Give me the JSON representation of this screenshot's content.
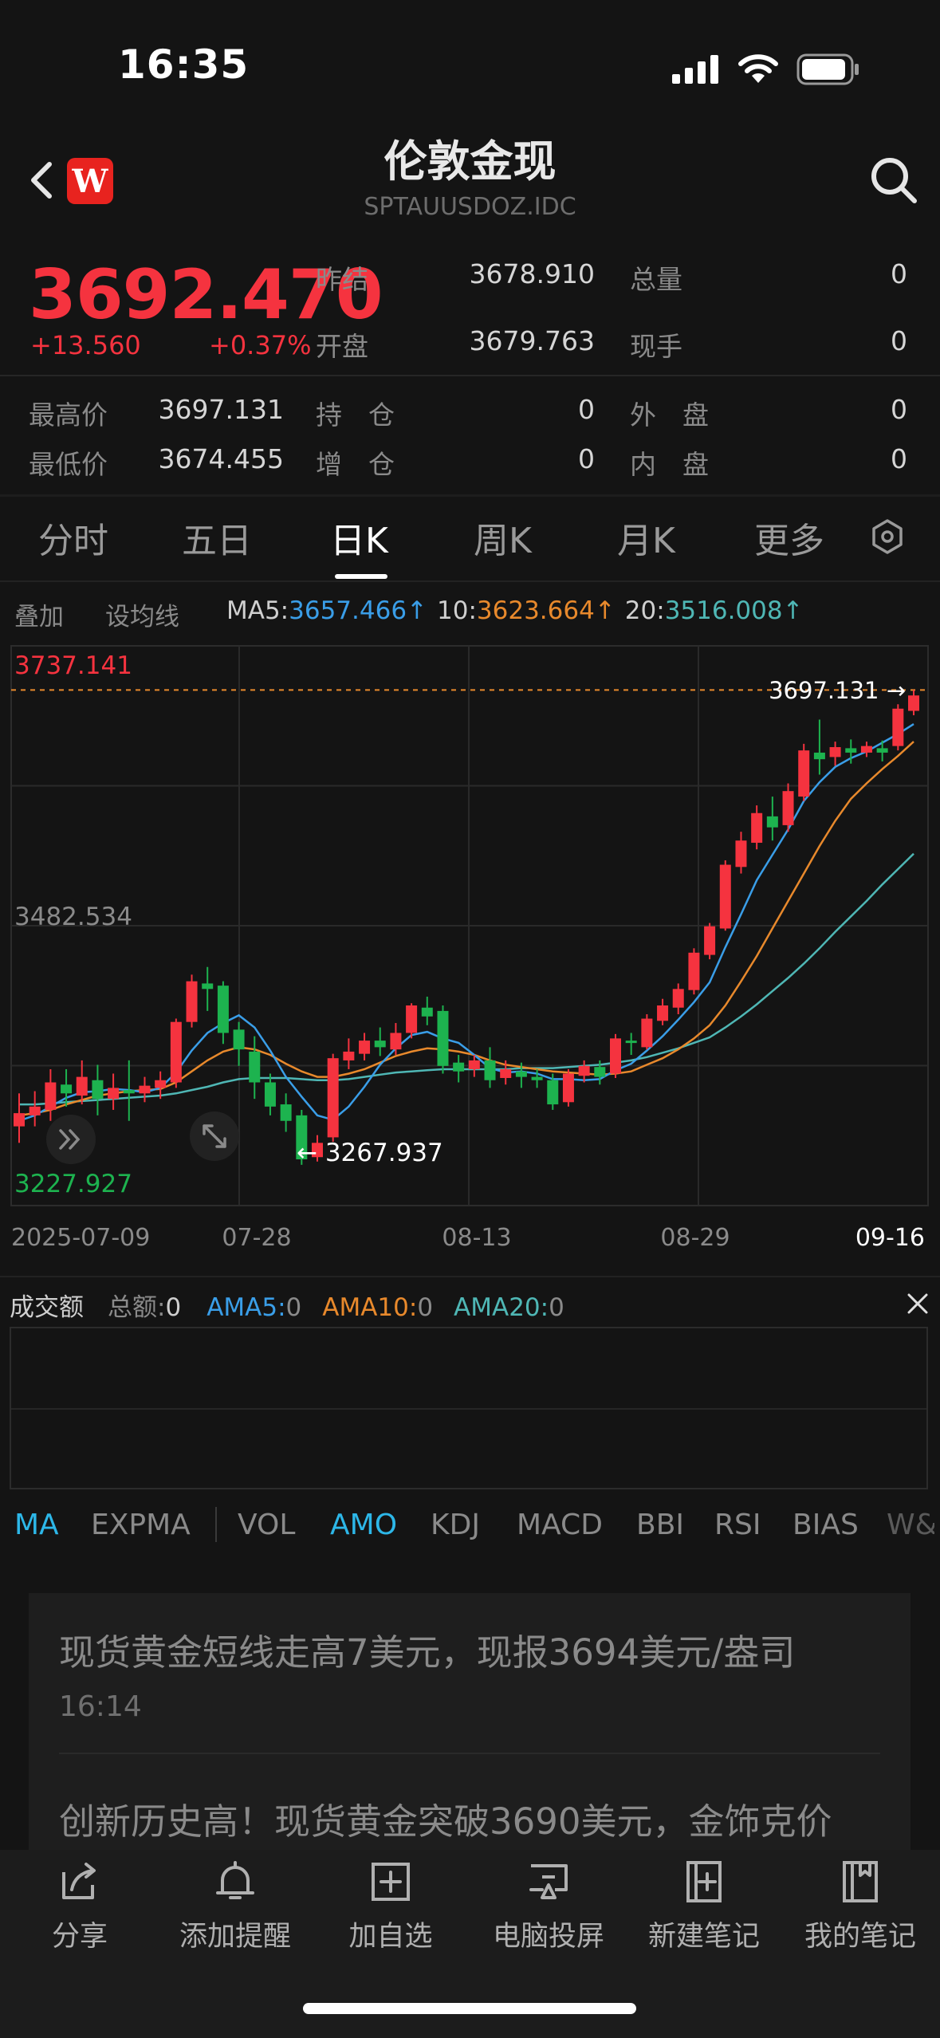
{
  "status": {
    "time": "16:35"
  },
  "header": {
    "title": "伦敦金现",
    "subtitle": "SPTAUUSDOZ.IDC",
    "logo": "W"
  },
  "quote": {
    "price": "3692.470",
    "change": "+13.560",
    "change_pct": "+0.37%",
    "fields": [
      {
        "label": "昨结",
        "value": "3678.910"
      },
      {
        "label": "总量",
        "value": "0"
      },
      {
        "label": "开盘",
        "value": "3679.763"
      },
      {
        "label": "现手",
        "value": "0"
      },
      {
        "label": "最高价",
        "value": "3697.131"
      },
      {
        "label": "持　仓",
        "value": "0"
      },
      {
        "label": "外　盘",
        "value": "0"
      },
      {
        "label": "最低价",
        "value": "3674.455"
      },
      {
        "label": "增　仓",
        "value": "0"
      },
      {
        "label": "内　盘",
        "value": "0"
      }
    ]
  },
  "tabs": [
    "分时",
    "五日",
    "日K",
    "周K",
    "月K",
    "更多"
  ],
  "active_tab": "日K",
  "ma_bar": {
    "overlay": "叠加",
    "set_ma": "设均线",
    "ma5_label": "MA5:",
    "ma5_value": "3657.466↑",
    "ma10_label": "10:",
    "ma10_value": "3623.664↑",
    "ma20_label": "20:",
    "ma20_value": "3516.008↑"
  },
  "chart_data": {
    "type": "candlestick",
    "y_top_label": "3737.141",
    "y_mid_label": "3482.534",
    "y_bottom_label": "3227.927",
    "ylim": [
      3227.927,
      3737.141
    ],
    "x_labels": [
      "2025-07-09",
      "07-28",
      "08-13",
      "08-29",
      "09-16"
    ],
    "max_annotation": "3697.131 →",
    "min_annotation": "← 3267.937",
    "candles": [
      [
        3300,
        3312,
        3285,
        3330
      ],
      [
        3310,
        3318,
        3300,
        3332
      ],
      [
        3315,
        3340,
        3305,
        3352
      ],
      [
        3338,
        3330,
        3318,
        3352
      ],
      [
        3328,
        3345,
        3320,
        3360
      ],
      [
        3342,
        3325,
        3310,
        3356
      ],
      [
        3325,
        3335,
        3315,
        3348
      ],
      [
        3333,
        3330,
        3305,
        3360
      ],
      [
        3330,
        3337,
        3322,
        3345
      ],
      [
        3335,
        3342,
        3325,
        3350
      ],
      [
        3340,
        3395,
        3335,
        3398
      ],
      [
        3395,
        3432,
        3390,
        3438
      ],
      [
        3430,
        3425,
        3405,
        3445
      ],
      [
        3428,
        3385,
        3375,
        3432
      ],
      [
        3388,
        3370,
        3355,
        3395
      ],
      [
        3368,
        3340,
        3325,
        3382
      ],
      [
        3340,
        3318,
        3310,
        3348
      ],
      [
        3320,
        3305,
        3295,
        3330
      ],
      [
        3310,
        3270,
        3265,
        3315
      ],
      [
        3272,
        3285,
        3268,
        3292
      ],
      [
        3290,
        3362,
        3286,
        3366
      ],
      [
        3360,
        3368,
        3352,
        3380
      ],
      [
        3366,
        3378,
        3360,
        3385
      ],
      [
        3378,
        3372,
        3364,
        3390
      ],
      [
        3370,
        3385,
        3365,
        3394
      ],
      [
        3385,
        3410,
        3380,
        3412
      ],
      [
        3408,
        3400,
        3392,
        3418
      ],
      [
        3405,
        3355,
        3348,
        3410
      ],
      [
        3358,
        3350,
        3340,
        3365
      ],
      [
        3352,
        3360,
        3345,
        3365
      ],
      [
        3360,
        3342,
        3335,
        3372
      ],
      [
        3344,
        3352,
        3338,
        3360
      ],
      [
        3350,
        3345,
        3335,
        3358
      ],
      [
        3345,
        3342,
        3335,
        3352
      ],
      [
        3342,
        3320,
        3315,
        3348
      ],
      [
        3322,
        3348,
        3318,
        3352
      ],
      [
        3346,
        3355,
        3340,
        3360
      ],
      [
        3354,
        3345,
        3338,
        3360
      ],
      [
        3348,
        3380,
        3344,
        3384
      ],
      [
        3378,
        3376,
        3365,
        3385
      ],
      [
        3372,
        3398,
        3370,
        3402
      ],
      [
        3396,
        3410,
        3392,
        3416
      ],
      [
        3408,
        3425,
        3402,
        3430
      ],
      [
        3424,
        3458,
        3420,
        3462
      ],
      [
        3456,
        3482,
        3452,
        3485
      ],
      [
        3480,
        3538,
        3478,
        3542
      ],
      [
        3536,
        3560,
        3530,
        3568
      ],
      [
        3558,
        3585,
        3552,
        3592
      ],
      [
        3582,
        3572,
        3560,
        3600
      ],
      [
        3574,
        3605,
        3568,
        3612
      ],
      [
        3600,
        3642,
        3596,
        3648
      ],
      [
        3640,
        3634,
        3620,
        3670
      ],
      [
        3636,
        3645,
        3628,
        3650
      ],
      [
        3644,
        3640,
        3630,
        3652
      ],
      [
        3640,
        3646,
        3636,
        3650
      ],
      [
        3644,
        3640,
        3632,
        3651
      ],
      [
        3646,
        3680,
        3642,
        3684
      ],
      [
        3678,
        3692,
        3674,
        3697
      ]
    ],
    "ma5": [
      3305,
      3310,
      3318,
      3326,
      3331,
      3332,
      3334,
      3333,
      3331,
      3335,
      3349,
      3369,
      3385,
      3394,
      3401,
      3390,
      3369,
      3345,
      3327,
      3310,
      3306,
      3318,
      3336,
      3356,
      3371,
      3383,
      3386,
      3380,
      3376,
      3365,
      3353,
      3349,
      3350,
      3348,
      3343,
      3343,
      3342,
      3343,
      3351,
      3357,
      3369,
      3382,
      3397,
      3413,
      3431,
      3463,
      3493,
      3524,
      3547,
      3570,
      3596,
      3613,
      3627,
      3635,
      3641,
      3649,
      3657,
      3666
    ],
    "ma10": [
      3310,
      3312,
      3315,
      3320,
      3324,
      3328,
      3330,
      3332,
      3333,
      3334,
      3340,
      3350,
      3360,
      3368,
      3372,
      3370,
      3365,
      3357,
      3350,
      3345,
      3345,
      3348,
      3352,
      3358,
      3364,
      3368,
      3371,
      3370,
      3368,
      3365,
      3360,
      3356,
      3354,
      3352,
      3350,
      3349,
      3348,
      3347,
      3348,
      3350,
      3356,
      3362,
      3370,
      3380,
      3392,
      3410,
      3432,
      3455,
      3480,
      3505,
      3530,
      3555,
      3578,
      3598,
      3612,
      3625,
      3637,
      3650
    ],
    "ma20": [
      3320,
      3320,
      3321,
      3322,
      3323,
      3324,
      3325,
      3326,
      3327,
      3328,
      3330,
      3333,
      3336,
      3340,
      3343,
      3344,
      3344,
      3344,
      3343,
      3342,
      3342,
      3343,
      3345,
      3347,
      3349,
      3350,
      3351,
      3352,
      3352,
      3352,
      3352,
      3352,
      3353,
      3353,
      3353,
      3354,
      3355,
      3356,
      3358,
      3360,
      3363,
      3367,
      3371,
      3376,
      3381,
      3390,
      3400,
      3411,
      3423,
      3435,
      3448,
      3462,
      3477,
      3491,
      3505,
      3520,
      3534,
      3548
    ],
    "colors": {
      "up": "#f5333f",
      "down": "#1db34f",
      "ma5": "#3a9ee8",
      "ma10": "#e8892c",
      "ma20": "#4fb7b5"
    }
  },
  "volume": {
    "title": "成交额",
    "total_label": "总额:",
    "total_value": "0",
    "ama5_label": "AMA5:",
    "ama5_value": "0",
    "ama10_label": "AMA10:",
    "ama10_value": "0",
    "ama20_label": "AMA20:",
    "ama20_value": "0"
  },
  "indicators": [
    "MA",
    "EXPMA",
    "VOL",
    "AMO",
    "KDJ",
    "MACD",
    "BBI",
    "RSI",
    "BIAS",
    "W&"
  ],
  "active_indicators": [
    "MA",
    "AMO"
  ],
  "news": [
    {
      "title": "现货黄金短线走高7美元，现报3694美元/盎司",
      "time": "16:14"
    },
    {
      "title": "创新历史高！现货黄金突破3690美元，金饰克价"
    }
  ],
  "footer": [
    {
      "label": "分享",
      "icon": "share-icon"
    },
    {
      "label": "添加提醒",
      "icon": "bell-icon"
    },
    {
      "label": "加自选",
      "icon": "add-box-icon"
    },
    {
      "label": "电脑投屏",
      "icon": "cast-screen-icon"
    },
    {
      "label": "新建笔记",
      "icon": "new-note-icon"
    },
    {
      "label": "我的笔记",
      "icon": "notebook-icon"
    }
  ]
}
